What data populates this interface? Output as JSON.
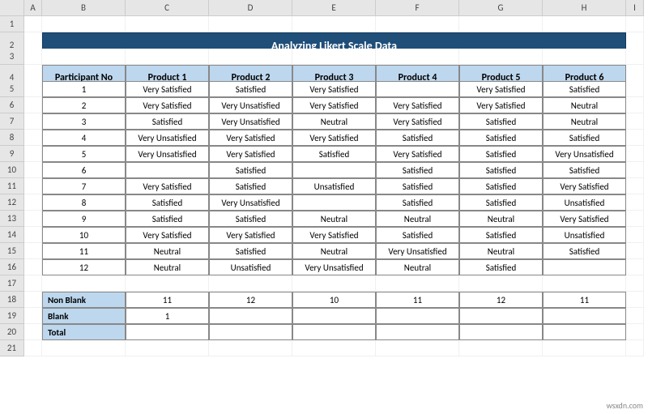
{
  "columns": [
    "A",
    "B",
    "C",
    "D",
    "E",
    "F",
    "G",
    "H",
    "I"
  ],
  "title": "Analyzing Likert Scale Data",
  "headers": [
    "Participant No",
    "Product 1",
    "Product 2",
    "Product 3",
    "Product 4",
    "Product 5",
    "Product 6"
  ],
  "rows": [
    {
      "n": "1",
      "v": [
        "Very Satisfied",
        "Satisfied",
        "Very Satisfied",
        "",
        "Very Satisfied",
        "Satisfied"
      ]
    },
    {
      "n": "2",
      "v": [
        "Very Satisfied",
        "Very Unsatisfied",
        "Very Satisfied",
        "Very Satisfied",
        "Very Satisfied",
        "Neutral"
      ]
    },
    {
      "n": "3",
      "v": [
        "Satisfied",
        "Very Unsatisfied",
        "Neutral",
        "Very Satisfied",
        "Satisfied",
        "Neutral"
      ]
    },
    {
      "n": "4",
      "v": [
        "Very Unsatisfied",
        "Very Satisfied",
        "Very Satisfied",
        "Satisfied",
        "Satisfied",
        "Satisfied"
      ]
    },
    {
      "n": "5",
      "v": [
        "Very Unsatisfied",
        "Very Satisfied",
        "Satisfied",
        "Very Satisfied",
        "Satisfied",
        "Very Unsatisfied"
      ]
    },
    {
      "n": "6",
      "v": [
        "",
        "Satisfied",
        "",
        "Satisfied",
        "Satisfied",
        "Satisfied"
      ]
    },
    {
      "n": "7",
      "v": [
        "Very Satisfied",
        "Satisfied",
        "Unsatisfied",
        "Satisfied",
        "Satisfied",
        "Very Satisfied"
      ]
    },
    {
      "n": "8",
      "v": [
        "Satisfied",
        "Very Unsatisfied",
        "",
        "Satisfied",
        "Satisfied",
        "Unsatisfied"
      ]
    },
    {
      "n": "9",
      "v": [
        "Satisfied",
        "Satisfied",
        "Neutral",
        "Neutral",
        "Neutral",
        "Very Satisfied"
      ]
    },
    {
      "n": "10",
      "v": [
        "Very Satisfied",
        "Very Satisfied",
        "Very Satisfied",
        "Satisfied",
        "Satisfied",
        "Unsatisfied"
      ]
    },
    {
      "n": "11",
      "v": [
        "Neutral",
        "Satisfied",
        "Neutral",
        "Very Unsatisfied",
        "Neutral",
        "Satisfied"
      ]
    },
    {
      "n": "12",
      "v": [
        "Neutral",
        "Unsatisfied",
        "Very Unsatisfied",
        "Neutral",
        "Satisfied",
        ""
      ]
    }
  ],
  "summary": [
    {
      "label": "Non Blank",
      "v": [
        "11",
        "12",
        "10",
        "11",
        "12",
        "11"
      ]
    },
    {
      "label": "Blank",
      "v": [
        "1",
        "",
        "",
        "",
        "",
        ""
      ]
    },
    {
      "label": "Total",
      "v": [
        "",
        "",
        "",
        "",
        "",
        ""
      ]
    }
  ],
  "watermark": "wsxdn.com"
}
